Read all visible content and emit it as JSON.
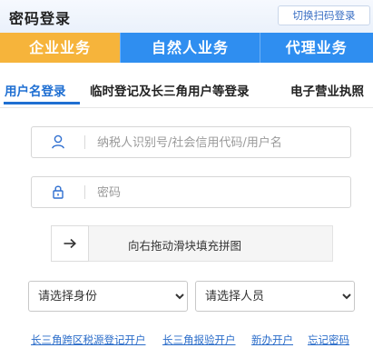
{
  "header": {
    "title": "密码登录",
    "switch_button": "切换扫码登录"
  },
  "business_tabs": [
    "企业业务",
    "自然人业务",
    "代理业务"
  ],
  "login_tabs": [
    "用户名登录",
    "临时登记及长三角用户等登录",
    "电子营业执照"
  ],
  "form": {
    "username_placeholder": "纳税人识别号/社会信用代码/用户名",
    "password_placeholder": "密码",
    "slider_text": "向右拖动滑块填充拼图",
    "identity_select": "请选择身份",
    "person_select": "请选择人员"
  },
  "links": [
    "长三角跨区税源登记开户",
    "长三角报验开户",
    "新办开户",
    "忘记密码"
  ],
  "colors": {
    "enterprise_tab": "#f6b43b",
    "tab_blue": "#2f8ef0",
    "active_blue": "#1f6fd2",
    "link": "#2a6cc9"
  }
}
